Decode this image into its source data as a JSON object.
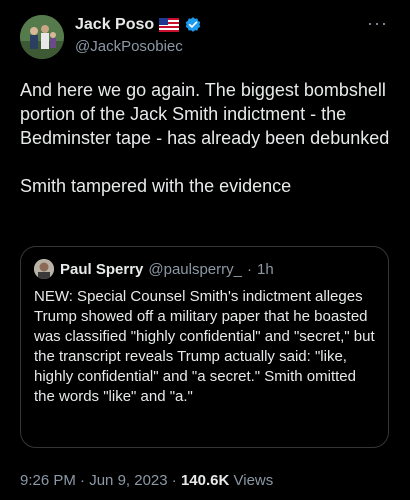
{
  "author": {
    "display_name": "Jack Poso",
    "handle": "@JackPosobiec",
    "verified": true,
    "flag": "us-flag-icon"
  },
  "tweet": {
    "paragraphs": [
      "And here we go again. The biggest bombshell portion of the Jack Smith indictment - the Bedminster tape - has already been debunked",
      "Smith tampered with the evidence"
    ]
  },
  "quoted": {
    "display_name": "Paul Sperry",
    "handle": "@paulsperry_",
    "separator": "·",
    "time": "1h",
    "text": "NEW: Special Counsel Smith's indictment alleges Trump showed off a military paper that he boasted was classified \"highly confidential\" and \"secret,\" but the transcript reveals Trump actually said: \"like, highly confidential\" and \"a secret.\" Smith omitted the words \"like\" and \"a.\""
  },
  "footer": {
    "time": "9:26 PM",
    "sep1": "·",
    "date": "Jun 9, 2023",
    "sep2": "·",
    "views_count": "140.6K",
    "views_label": "Views"
  },
  "colors": {
    "background": "#000000",
    "text": "#e7e9ea",
    "secondary": "#8b98a5",
    "verified": "#1d9bf0",
    "border": "#333639"
  }
}
